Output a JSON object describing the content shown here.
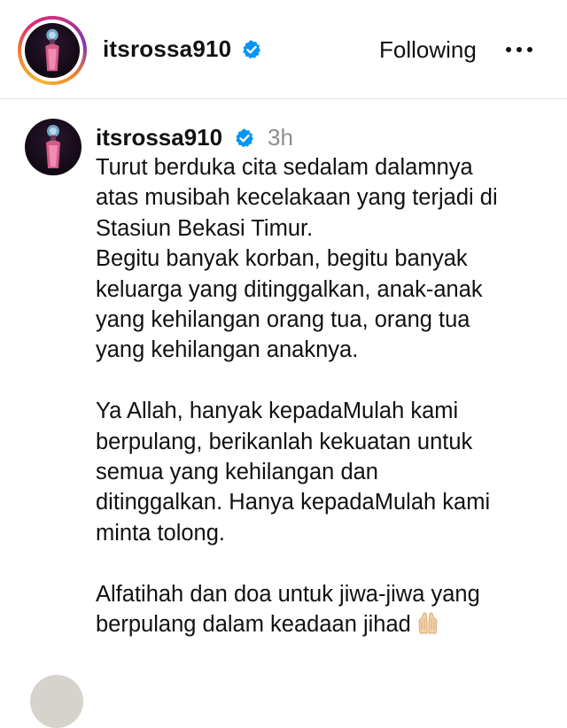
{
  "header": {
    "username": "itsrossa910",
    "verified": true,
    "following_label": "Following",
    "more_label": "•••"
  },
  "post": {
    "username": "itsrossa910",
    "verified": true,
    "time": "3h",
    "paragraphs": [
      "Turut berduka cita sedalam dalamnya\natas musibah kecelakaan yang terjadi di\nStasiun Bekasi Timur.\nBegitu banyak korban, begitu banyak\nkeluarga yang ditinggalkan, anak-anak\nyang kehilangan orang tua, orang tua\nyang kehilangan anaknya.",
      "Ya Allah, hanyak kepadaMulah kami\nberpulang, berikanlah kekuatan untuk\nsemua yang kehilangan dan\nditinggalkan. Hanya kepadaMulah kami\nminta tolong.",
      "Alfatihah dan doa untuk jiwa-jiwa yang\nberpulang dalam keadaan jihad"
    ],
    "trailing_emoji": "praying-hands-emoji"
  },
  "colors": {
    "verified_blue": "#0095f6",
    "muted_text": "#8e8e8e",
    "divider": "#e6e6e6"
  }
}
